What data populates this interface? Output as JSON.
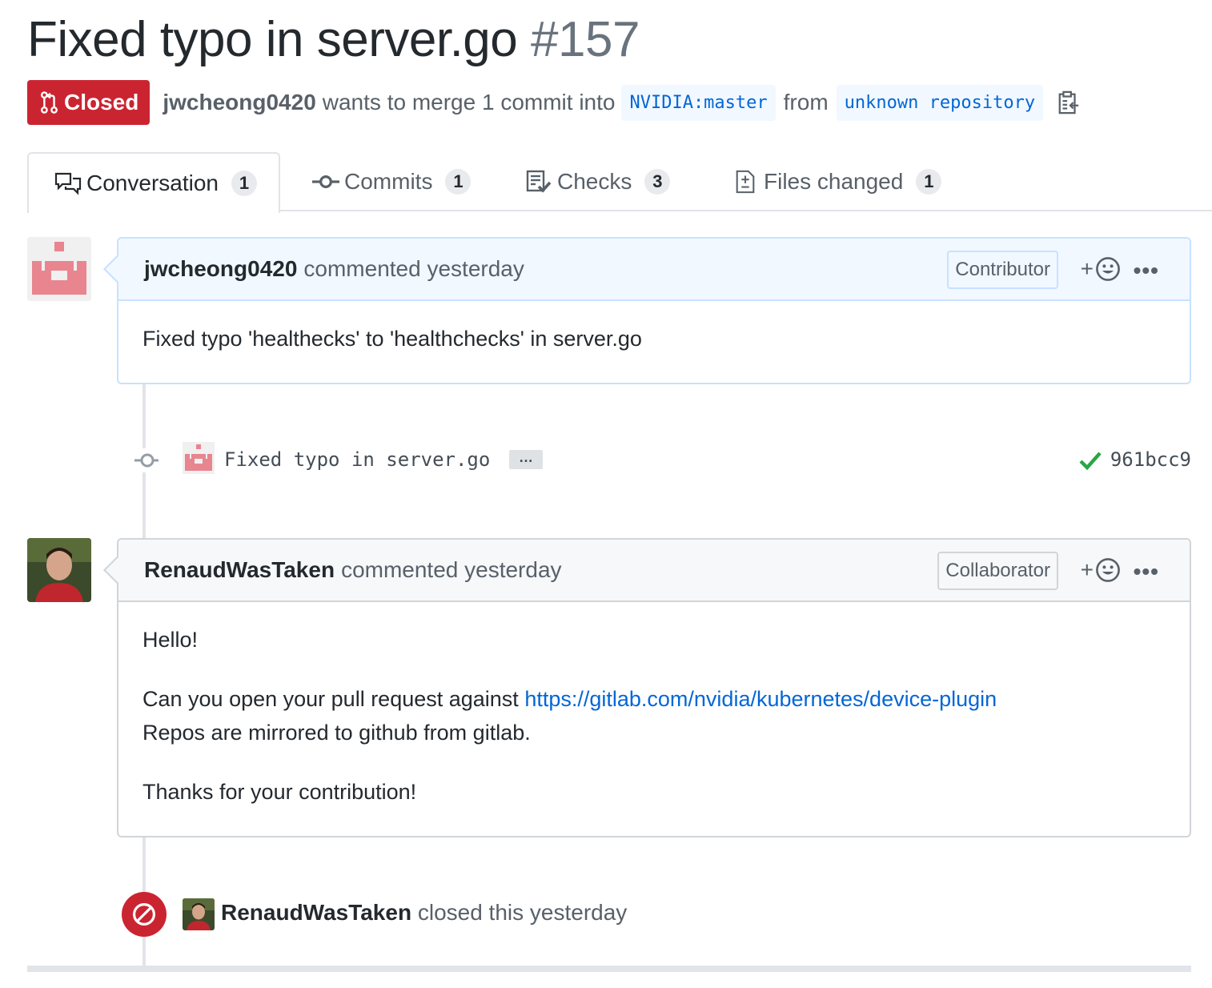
{
  "pr": {
    "title": "Fixed typo in server.go",
    "number": "#157",
    "state": "Closed",
    "author": "jwcheong0420",
    "merge_text": "wants to merge 1 commit into",
    "base_ref": "NVIDIA:master",
    "from_text": "from",
    "head_ref": "unknown repository"
  },
  "tabs": [
    {
      "label": "Conversation",
      "count": "1",
      "icon": "conversation-icon"
    },
    {
      "label": "Commits",
      "count": "1",
      "icon": "commit-icon"
    },
    {
      "label": "Checks",
      "count": "3",
      "icon": "checklist-icon"
    },
    {
      "label": "Files changed",
      "count": "1",
      "icon": "file-diff-icon"
    }
  ],
  "comments": [
    {
      "author": "jwcheong0420",
      "action": "commented yesterday",
      "role": "Contributor",
      "react": "+",
      "more": "•••",
      "body": [
        "Fixed typo 'healthecks' to 'healthchecks' in server.go"
      ]
    },
    {
      "author": "RenaudWasTaken",
      "action": "commented yesterday",
      "role": "Collaborator",
      "react": "+",
      "more": "•••",
      "hello": "Hello!",
      "line1_prefix": "Can you open your pull request against ",
      "link": "https://gitlab.com/nvidia/kubernetes/device-plugin",
      "line2": "Repos are mirrored to github from gitlab.",
      "thanks": "Thanks for your contribution!"
    }
  ],
  "commit": {
    "message": "Fixed typo in server.go",
    "ellipsis": "…",
    "sha": "961bcc9",
    "status": "success"
  },
  "closed_event": {
    "actor": "RenaudWasTaken",
    "text": "closed this yesterday"
  },
  "colors": {
    "closed_red": "#cb2431",
    "link_blue": "#0366d6",
    "success_green": "#28a745"
  }
}
